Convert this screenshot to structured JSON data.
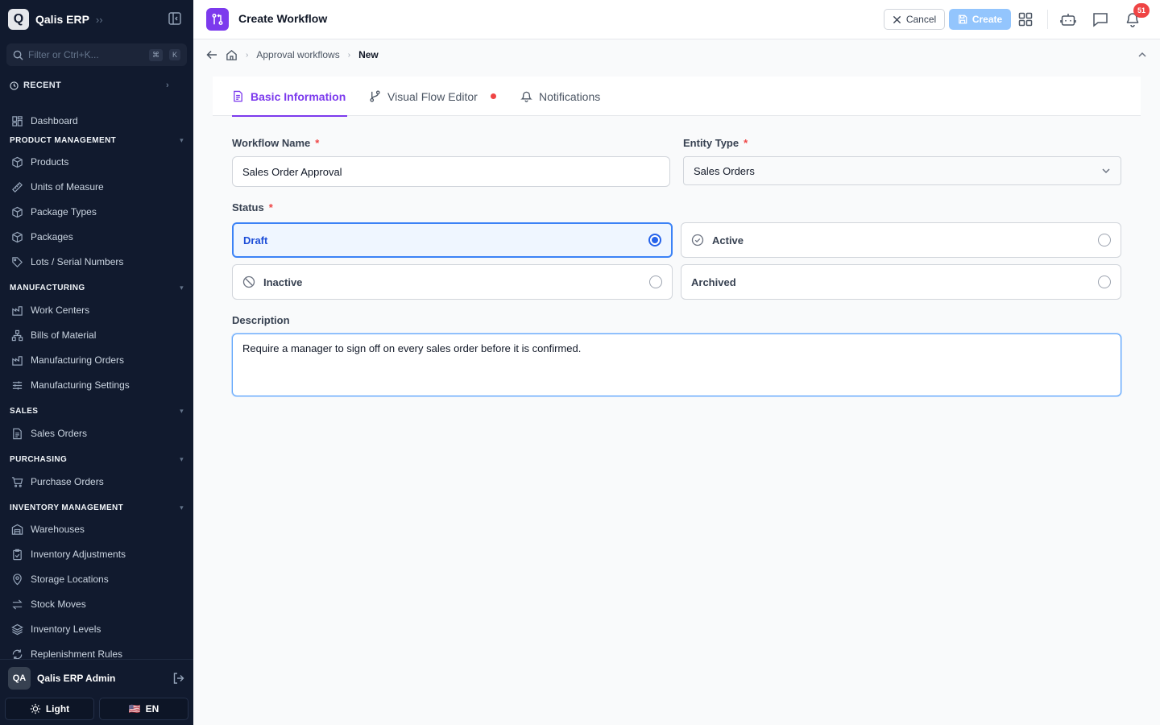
{
  "sidebar": {
    "brand": {
      "logo": "Q",
      "name": "Qalis ERP"
    },
    "filter_placeholder": "Filter or Ctrl+K...",
    "filter_keys": [
      "⌘",
      "K"
    ],
    "recent_label": "RECENT",
    "dashboard": "Dashboard",
    "sections": {
      "product": {
        "title": "PRODUCT MANAGEMENT",
        "items": [
          "Products",
          "Units of Measure",
          "Package Types",
          "Packages",
          "Lots / Serial Numbers"
        ]
      },
      "manufacturing": {
        "title": "MANUFACTURING",
        "items": [
          "Work Centers",
          "Bills of Material",
          "Manufacturing Orders",
          "Manufacturing Settings"
        ]
      },
      "sales": {
        "title": "SALES",
        "items": [
          "Sales Orders"
        ]
      },
      "purchasing": {
        "title": "PURCHASING",
        "items": [
          "Purchase Orders"
        ]
      },
      "inventory": {
        "title": "INVENTORY MANAGEMENT",
        "items": [
          "Warehouses",
          "Inventory Adjustments",
          "Storage Locations",
          "Stock Moves",
          "Inventory Levels",
          "Replenishment Rules"
        ]
      }
    },
    "user": {
      "initials": "QA",
      "name": "Qalis ERP Admin"
    },
    "theme_label": "Light",
    "language_flag": "🇺🇸",
    "language_label": "EN"
  },
  "topbar": {
    "title": "Create Workflow",
    "cancel_label": "Cancel",
    "create_label": "Create",
    "notification_count": "51"
  },
  "breadcrumb": {
    "parent": "Approval workflows",
    "current": "New"
  },
  "tabs": [
    "Basic Information",
    "Visual Flow Editor",
    "Notifications"
  ],
  "form": {
    "workflow_name_label": "Workflow Name",
    "workflow_name_value": "Sales Order Approval",
    "entity_type_label": "Entity Type",
    "entity_type_value": "Sales Orders",
    "required_mark": "*",
    "status_label": "Status",
    "status_options": [
      "Draft",
      "Active",
      "Inactive",
      "Archived"
    ],
    "status_selected": "Draft",
    "description_label": "Description",
    "description_value": "Require a manager to sign off on every sales order before it is confirmed."
  },
  "colors": {
    "sidebar_bg": "#111a2e",
    "accent": "#7c3aed",
    "primary": "#3b82f6",
    "danger": "#ef4444"
  }
}
